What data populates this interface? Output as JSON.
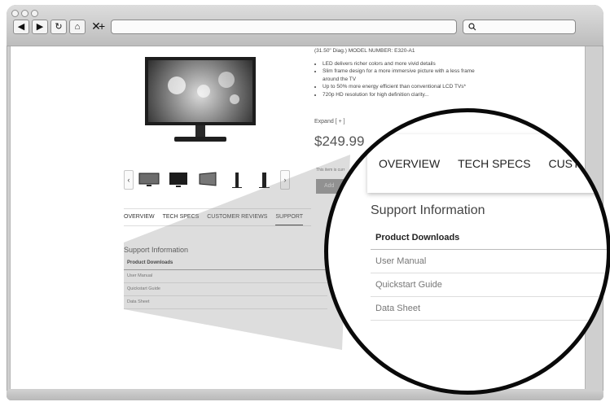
{
  "browser": {
    "nav": {
      "back": "◀",
      "forward": "▶",
      "reload": "↻",
      "home": "⌂",
      "stop": "✕",
      "new_tab": "+"
    },
    "search_icon": "magnifier-icon"
  },
  "product": {
    "header_line": "(31.50\" Diag.) MODEL NUMBER: E320-A1",
    "features": [
      "LED delivers richer colors and more vivid details",
      "Slim frame design for a more immersive picture with a less frame around the TV",
      "Up to 50% more energy efficient than conventional LCD TVs*",
      "720p HD resolution for high definition clarity..."
    ],
    "expand": "Expand [ + ]",
    "price": "$249.99",
    "note": "This item is curr",
    "add_button": "Add"
  },
  "thumbnails": {
    "prev": "‹",
    "next": "›"
  },
  "tabs": [
    "OVERVIEW",
    "TECH SPECS",
    "CUSTOMER REVIEWS",
    "SUPPORT"
  ],
  "support": {
    "title": "Support Information",
    "header": "Product Downloads",
    "rows": [
      "User Manual",
      "Quickstart Guide",
      "Data Sheet"
    ]
  },
  "magnified": {
    "tabs": [
      "OVERVIEW",
      "TECH SPECS",
      "CUSTO"
    ]
  }
}
